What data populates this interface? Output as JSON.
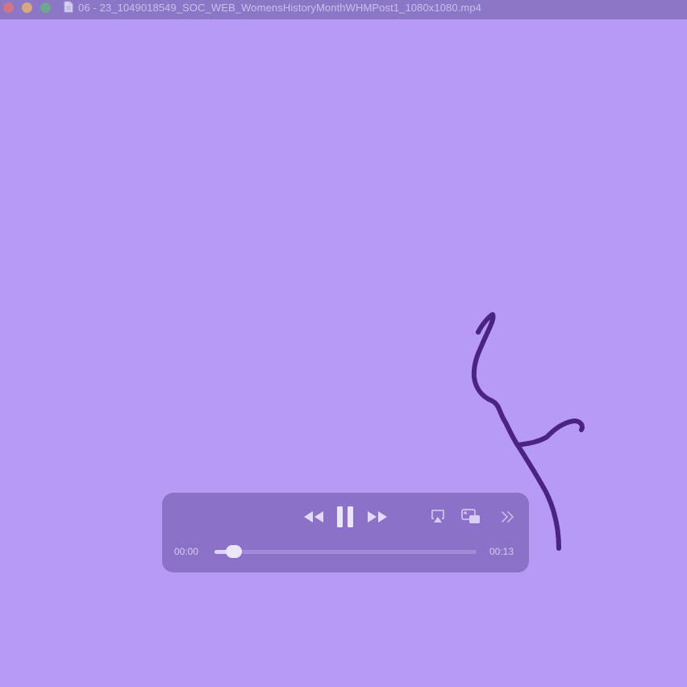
{
  "window": {
    "title": "06 - 23_1049018549_SOC_WEB_WomensHistoryMonthWHMPost1_1080x1080.mp4"
  },
  "player": {
    "current_time": "00:00",
    "total_time": "00:13",
    "progress": 0.05,
    "state": "playing"
  },
  "icons": {
    "doc": "document-icon",
    "rewind": "rewind-icon",
    "pause": "pause-icon",
    "forward": "fast-forward-icon",
    "airplay": "airplay-icon",
    "pip": "picture-in-picture-icon",
    "more": "chevron-double-right-icon"
  },
  "colors": {
    "background": "#b69af4",
    "titlebar": "#8c77c6",
    "controls": "#8b72c8",
    "stroke": "#4b2382"
  }
}
